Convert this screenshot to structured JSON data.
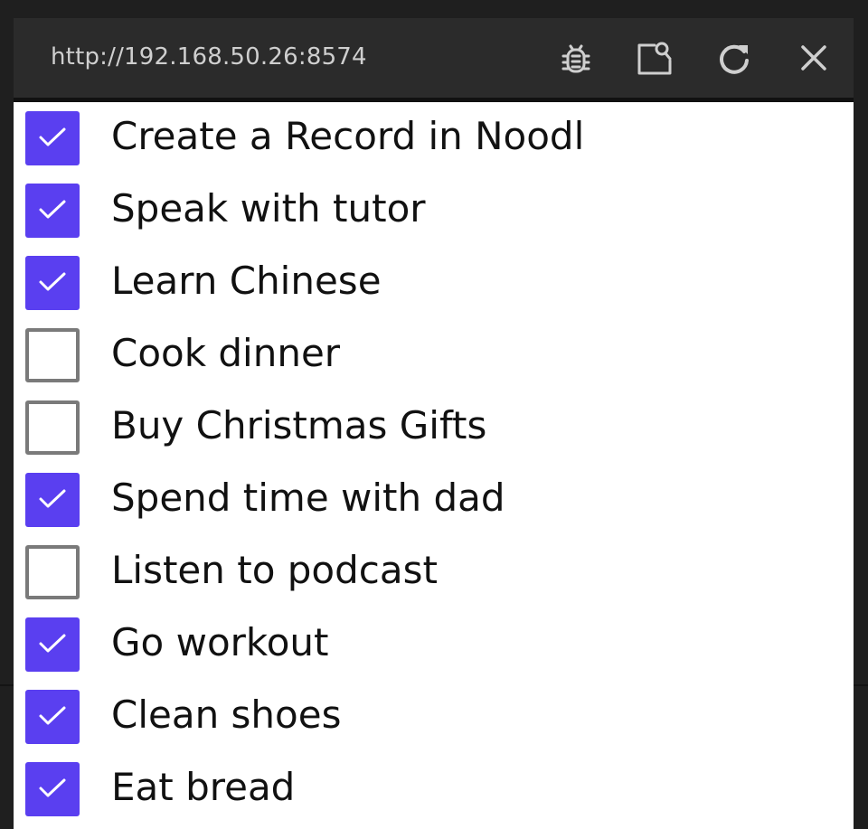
{
  "window": {
    "url": "http://192.168.50.26:8574",
    "toolbar": {
      "debug_icon": "bug-icon",
      "inspect_icon": "inspect-icon",
      "reload_icon": "reload-icon",
      "close_icon": "close-icon"
    }
  },
  "colors": {
    "accent": "#5a3ff0",
    "titlebar": "#2b2b2b",
    "unchecked_border": "#7a7a7a"
  },
  "todos": [
    {
      "label": "Create a Record in Noodl",
      "checked": true
    },
    {
      "label": "Speak with tutor",
      "checked": true
    },
    {
      "label": "Learn Chinese",
      "checked": true
    },
    {
      "label": "Cook dinner",
      "checked": false
    },
    {
      "label": "Buy Christmas Gifts",
      "checked": false
    },
    {
      "label": "Spend time with dad",
      "checked": true
    },
    {
      "label": "Listen to podcast",
      "checked": false
    },
    {
      "label": "Go workout",
      "checked": true
    },
    {
      "label": "Clean shoes",
      "checked": true
    },
    {
      "label": "Eat bread",
      "checked": true
    }
  ]
}
